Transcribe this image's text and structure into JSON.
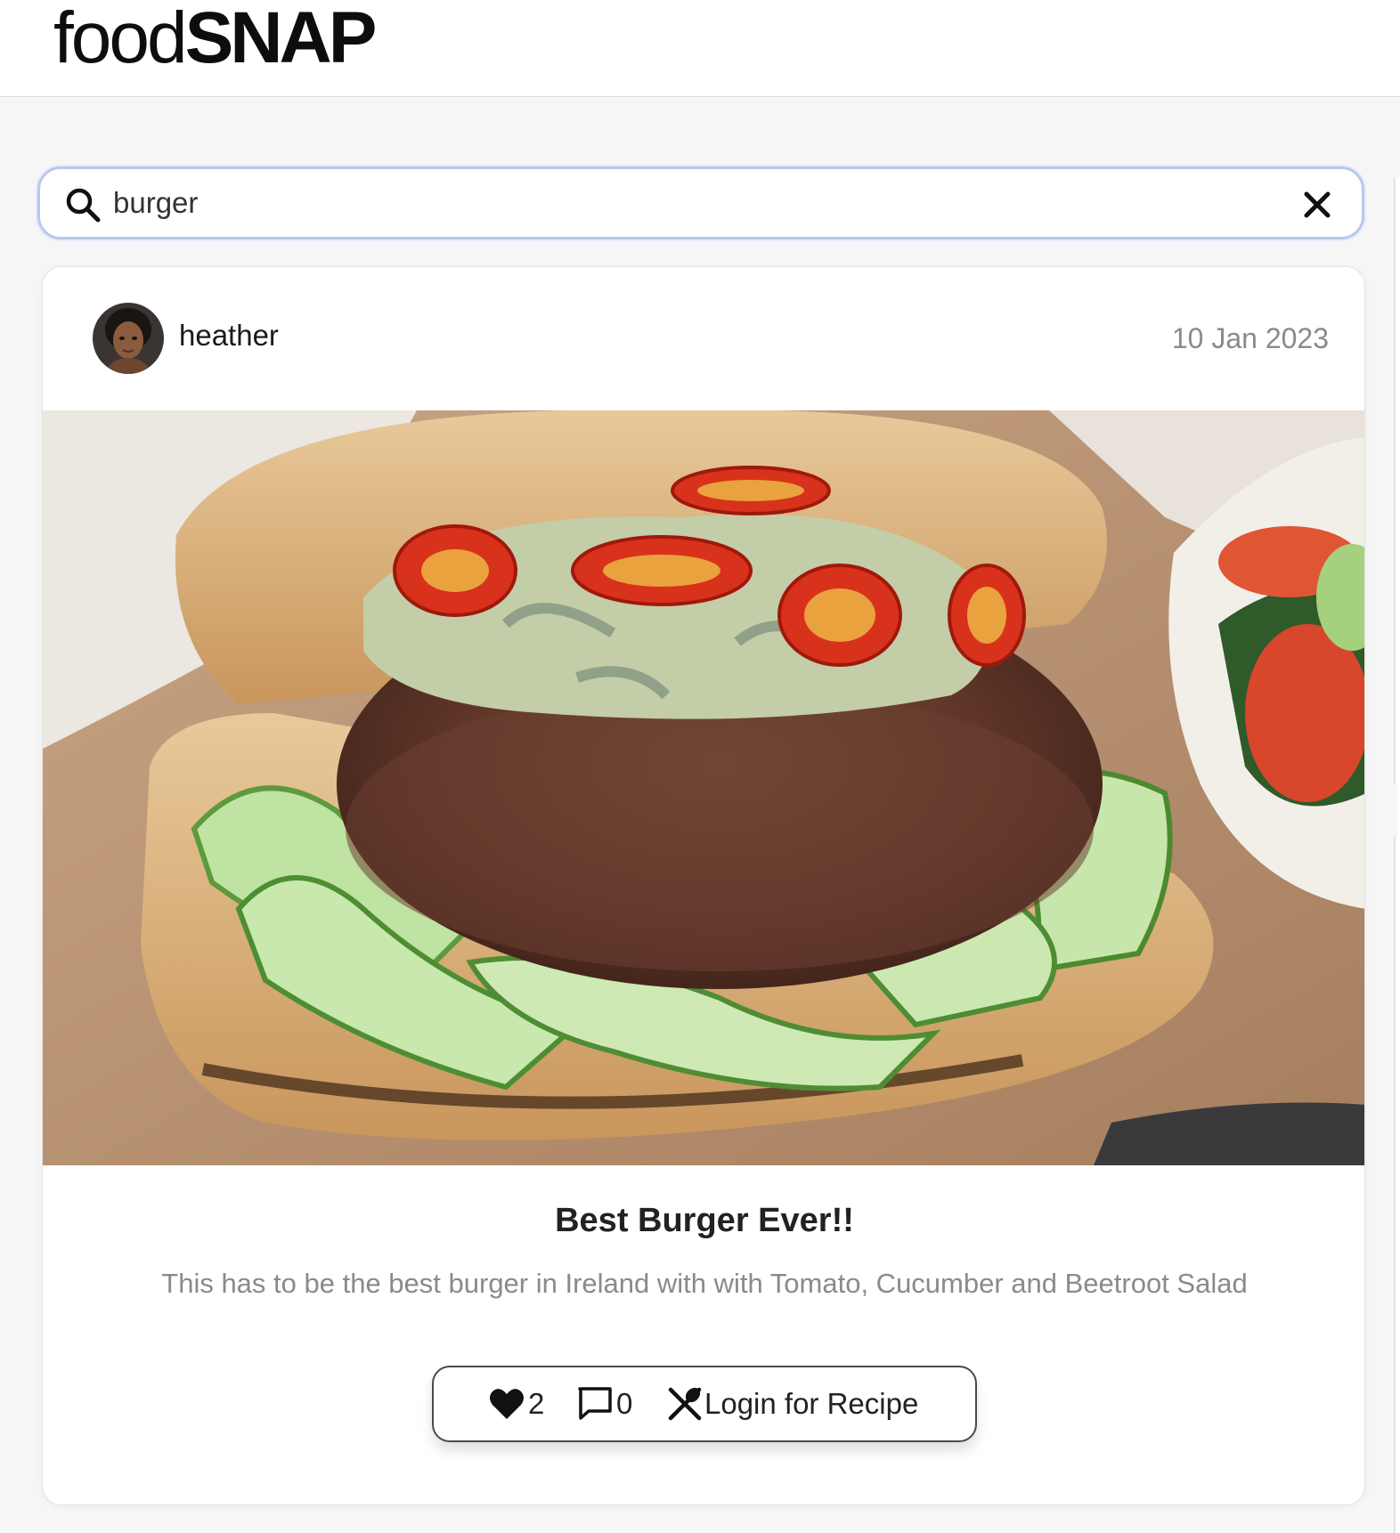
{
  "header": {
    "logo_light": "food",
    "logo_bold": "SNAP"
  },
  "search": {
    "value": "burger",
    "icon": "search-icon",
    "clear_icon": "close-icon"
  },
  "post": {
    "author": "heather",
    "date": "10 Jan 2023",
    "image_icon": "burger-photo",
    "title": "Best Burger Ever!!",
    "description": "This has to be the best burger in Ireland with with Tomato, Cucumber and Beetroot Salad",
    "likes": "2",
    "comments": "0",
    "recipe_label": "Login for Recipe",
    "like_icon": "heart-icon",
    "comment_icon": "comment-icon",
    "recipe_icon": "utensils-icon"
  },
  "colors": {
    "page_bg": "#f6f6f6",
    "search_border": "#b7c8ec",
    "muted_text": "#8a8a8a",
    "text": "#1c1c1c"
  }
}
